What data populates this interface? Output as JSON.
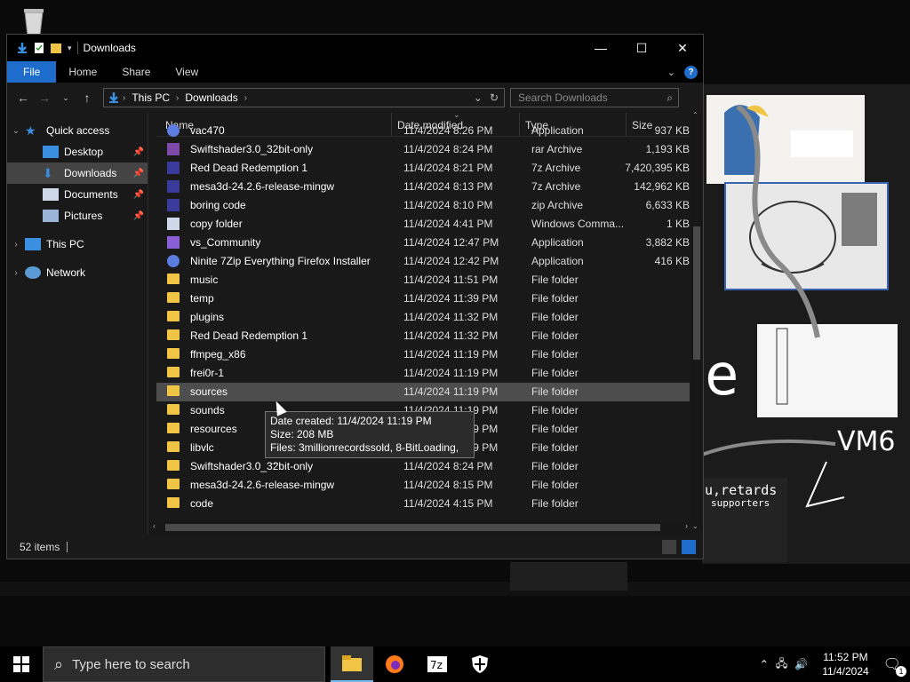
{
  "window": {
    "title": "Downloads",
    "tabs": [
      "File",
      "Home",
      "Share",
      "View"
    ]
  },
  "address": {
    "segments": [
      "This PC",
      "Downloads"
    ],
    "search_placeholder": "Search Downloads"
  },
  "navpane": {
    "items": [
      {
        "label": "Quick access",
        "icon": "star-icon"
      },
      {
        "label": "Desktop",
        "icon": "desktop-icon"
      },
      {
        "label": "Downloads",
        "icon": "download-icon"
      },
      {
        "label": "Documents",
        "icon": "documents-icon"
      },
      {
        "label": "Pictures",
        "icon": "pictures-icon"
      },
      {
        "label": "This PC",
        "icon": "computer-icon"
      },
      {
        "label": "Network",
        "icon": "network-icon"
      }
    ]
  },
  "columns": [
    "Name",
    "Date modified",
    "Type",
    "Size"
  ],
  "files": [
    {
      "name": "vac470",
      "date": "11/4/2024 8:26 PM",
      "type": "Application",
      "size": "937 KB",
      "icon": "app"
    },
    {
      "name": "Swiftshader3.0_32bit-only",
      "date": "11/4/2024 8:24 PM",
      "type": "rar Archive",
      "size": "1,193 KB",
      "icon": "rar"
    },
    {
      "name": "Red Dead Redemption 1",
      "date": "11/4/2024 8:21 PM",
      "type": "7z Archive",
      "size": "7,420,395 KB",
      "icon": "archive"
    },
    {
      "name": "mesa3d-24.2.6-release-mingw",
      "date": "11/4/2024 8:13 PM",
      "type": "7z Archive",
      "size": "142,962 KB",
      "icon": "archive"
    },
    {
      "name": "boring code",
      "date": "11/4/2024 8:10 PM",
      "type": "zip Archive",
      "size": "6,633 KB",
      "icon": "archive"
    },
    {
      "name": "copy folder",
      "date": "11/4/2024 4:41 PM",
      "type": "Windows Comma...",
      "size": "1 KB",
      "icon": "shortcut"
    },
    {
      "name": "vs_Community",
      "date": "11/4/2024 12:47 PM",
      "type": "Application",
      "size": "3,882 KB",
      "icon": "vs"
    },
    {
      "name": "Ninite 7Zip Everything Firefox Installer",
      "date": "11/4/2024 12:42 PM",
      "type": "Application",
      "size": "416 KB",
      "icon": "app"
    },
    {
      "name": "music",
      "date": "11/4/2024 11:51 PM",
      "type": "File folder",
      "size": "",
      "icon": "folder"
    },
    {
      "name": "temp",
      "date": "11/4/2024 11:39 PM",
      "type": "File folder",
      "size": "",
      "icon": "folder"
    },
    {
      "name": "plugins",
      "date": "11/4/2024 11:32 PM",
      "type": "File folder",
      "size": "",
      "icon": "folder"
    },
    {
      "name": "Red Dead Redemption 1",
      "date": "11/4/2024 11:32 PM",
      "type": "File folder",
      "size": "",
      "icon": "folder"
    },
    {
      "name": "ffmpeg_x86",
      "date": "11/4/2024 11:19 PM",
      "type": "File folder",
      "size": "",
      "icon": "folder"
    },
    {
      "name": "frei0r-1",
      "date": "11/4/2024 11:19 PM",
      "type": "File folder",
      "size": "",
      "icon": "folder"
    },
    {
      "name": "sources",
      "date": "11/4/2024 11:19 PM",
      "type": "File folder",
      "size": "",
      "icon": "folder",
      "hover": true
    },
    {
      "name": "sounds",
      "date": "11/4/2024 11:19 PM",
      "type": "File folder",
      "size": "",
      "icon": "folder"
    },
    {
      "name": "resources",
      "date": "11/4/2024 11:19 PM",
      "type": "File folder",
      "size": "",
      "icon": "folder"
    },
    {
      "name": "libvlc",
      "date": "11/4/2024 11:19 PM",
      "type": "File folder",
      "size": "",
      "icon": "folder"
    },
    {
      "name": "Swiftshader3.0_32bit-only",
      "date": "11/4/2024 8:24 PM",
      "type": "File folder",
      "size": "",
      "icon": "folder"
    },
    {
      "name": "mesa3d-24.2.6-release-mingw",
      "date": "11/4/2024 8:15 PM",
      "type": "File folder",
      "size": "",
      "icon": "folder"
    },
    {
      "name": "code",
      "date": "11/4/2024 4:15 PM",
      "type": "File folder",
      "size": "",
      "icon": "folder"
    }
  ],
  "tooltip": {
    "line1": "Date created: 11/4/2024 11:19 PM",
    "line2": "Size: 208 MB",
    "line3": "Files: 3millionrecordssold, 8-BitLoading, ..."
  },
  "status": {
    "items": "52 items"
  },
  "taskbar": {
    "search_placeholder": "Type here to search",
    "time": "11:52 PM",
    "date": "11/4/2024",
    "notification_count": "1",
    "apps": [
      "file-explorer-icon",
      "firefox-icon",
      "7zip-icon",
      "security-shield-icon"
    ]
  },
  "wallpaper": {
    "text_vm6": "VM6",
    "text_retards": "u,retards",
    "text_supporters": "supporters",
    "text_e": "e"
  },
  "colors": {
    "accent": "#1e6dcd",
    "folder": "#f0c444",
    "highlight": "#4d4d4d"
  }
}
